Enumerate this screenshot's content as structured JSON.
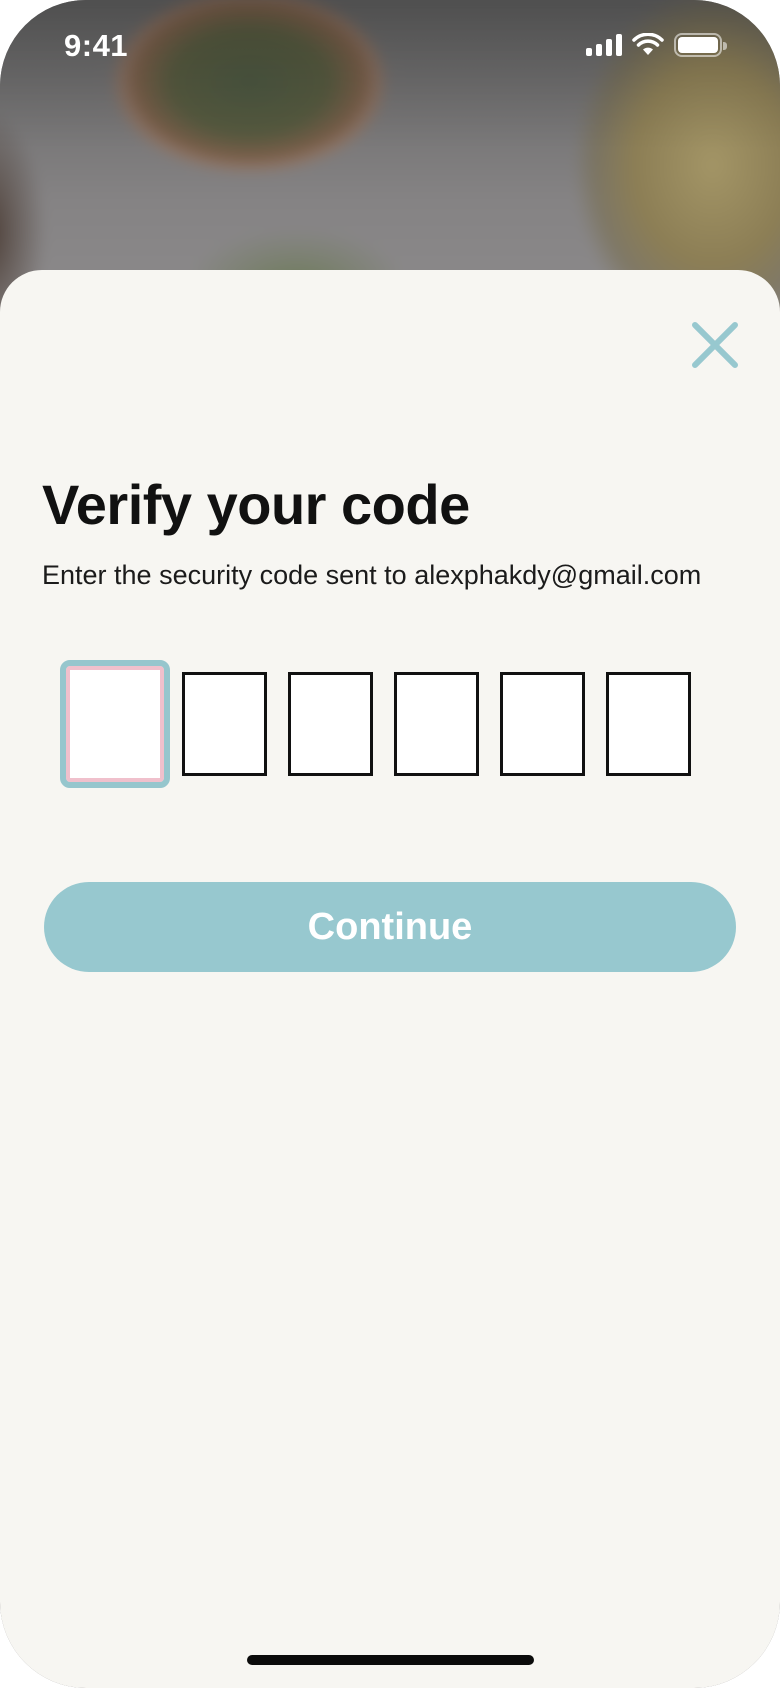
{
  "status_bar": {
    "time": "9:41",
    "icons": [
      "cellular-signal-icon",
      "wifi-icon",
      "battery-icon"
    ]
  },
  "sheet": {
    "close_icon": "close-icon",
    "title": "Verify your code",
    "subtitle": "Enter the security code sent to alexphakdy@gmail.com",
    "code_digits": [
      "",
      "",
      "",
      "",
      "",
      ""
    ],
    "continue_label": "Continue"
  },
  "colors": {
    "accent": "#97c8cf",
    "sheet_background": "#f7f6f2",
    "focus_inner": "#f0c0cc",
    "text": "#111111"
  }
}
